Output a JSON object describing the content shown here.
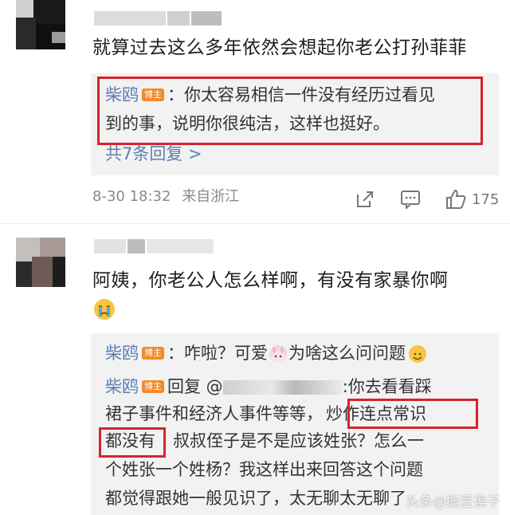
{
  "comments": [
    {
      "text": "就算过去这么多年依然会想起你老公打孙菲菲",
      "reply_author": "柴鸥",
      "badge": "博主",
      "reply_line1": "：你太容易相信一件没有经历过看见",
      "reply_line2": "到的事，说明你很纯洁，这样也挺好。",
      "more_replies": "共7条回复 >",
      "timestamp": "8-30 18:32",
      "source": "来自浙江",
      "likes": "175"
    },
    {
      "text_line1": "阿姨，你老公人怎么样啊，有没有家暴你啊",
      "reply1_author": "柴鸥",
      "reply1_badge": "博主",
      "reply1_text": "：咋啦？可爱",
      "reply1_text2": "为啥这么问问题",
      "reply2_author": "柴鸥",
      "reply2_badge": "博主",
      "reply2_prefix": "回复 @",
      "reply2_suffix": ":你去看看踩",
      "reply2_line2a": "裙子事件和经济人事件等等，",
      "reply2_line2b": "炒作连点常识",
      "reply2_line3a": "都没有",
      "reply2_line3b": "叔叔侄子是不是应该姓张？怎么一",
      "reply2_line4": "个姓张一个姓杨？我这样出来回答这个问题",
      "reply2_line5": "都觉得跟她一般见识了，太无聊太无聊了"
    }
  ],
  "watermark": "头条@能豆侯子",
  "colors": {
    "link": "#5d7fb1",
    "badge": "#f08a2b",
    "highlight_border": "#d6232a",
    "reply_bg": "#f2f2f2"
  },
  "icons": [
    "share-icon",
    "comment-icon",
    "like-icon",
    "crying-emoji",
    "bunny-emoji",
    "smile-emoji"
  ]
}
